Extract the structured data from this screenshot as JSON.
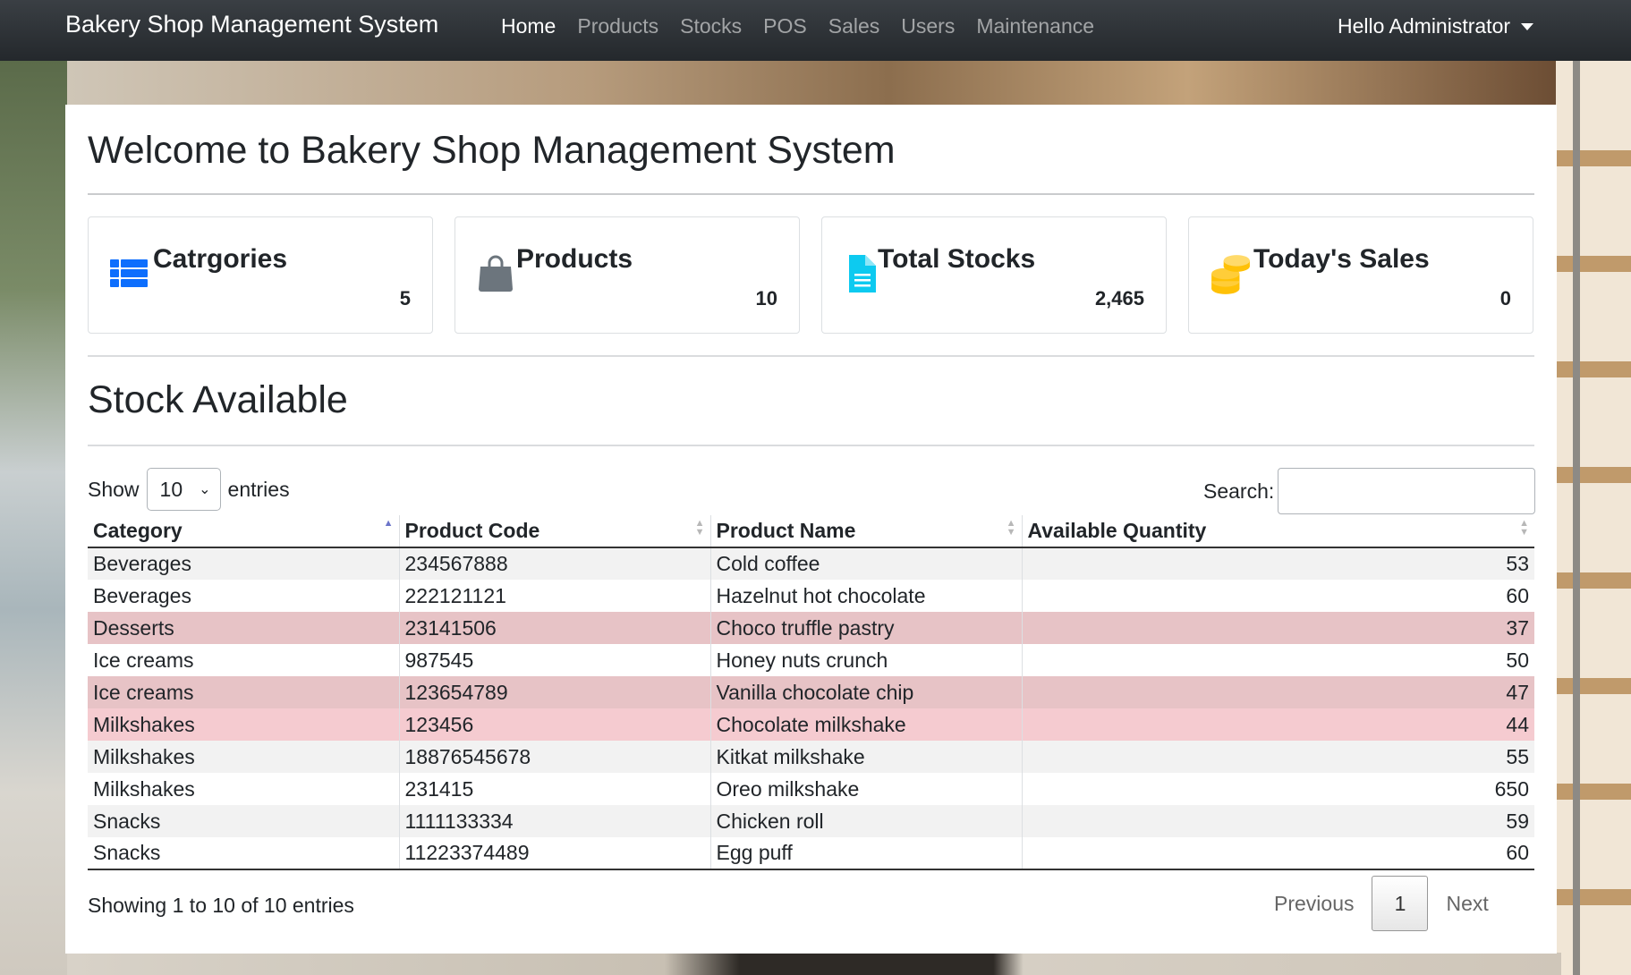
{
  "navbar": {
    "brand": "Bakery Shop Management System",
    "links": [
      "Home",
      "Products",
      "Stocks",
      "POS",
      "Sales",
      "Users",
      "Maintenance"
    ],
    "active": "Home",
    "user": "Hello Administrator"
  },
  "welcome": "Welcome to Bakery Shop Management System",
  "stats": [
    {
      "label": "Catrgories",
      "value": "5",
      "icon": "grid-list-icon",
      "color": "#0d6efd"
    },
    {
      "label": "Products",
      "value": "10",
      "icon": "shopping-bag-icon",
      "color": "#6c757d"
    },
    {
      "label": "Total Stocks",
      "value": "2,465",
      "icon": "file-document-icon",
      "color": "#0dcaf0"
    },
    {
      "label": "Today's Sales",
      "value": "0",
      "icon": "coins-icon",
      "color": "#ffc107"
    }
  ],
  "stock": {
    "title": "Stock Available",
    "show_label": "Show",
    "entries_label": "entries",
    "page_size": "10",
    "search_label": "Search:",
    "columns": [
      "Category",
      "Product Code",
      "Product Name",
      "Available Quantity"
    ],
    "rows": [
      [
        "Beverages",
        "234567888",
        "Cold coffee",
        "53"
      ],
      [
        "Beverages",
        "222121121",
        "Hazelnut hot chocolate",
        "60"
      ],
      [
        "Desserts",
        "23141506",
        "Choco truffle pastry",
        "37"
      ],
      [
        "Ice creams",
        "987545",
        "Honey nuts crunch",
        "50"
      ],
      [
        "Ice creams",
        "123654789",
        "Vanilla chocolate chip",
        "47"
      ],
      [
        "Milkshakes",
        "123456",
        "Chocolate milkshake",
        "44"
      ],
      [
        "Milkshakes",
        "18876545678",
        "Kitkat milkshake",
        "55"
      ],
      [
        "Milkshakes",
        "231415",
        "Oreo milkshake",
        "650"
      ],
      [
        "Snacks",
        "1111133334",
        "Chicken roll",
        "59"
      ],
      [
        "Snacks",
        "11223374489",
        "Egg puff",
        "60"
      ]
    ],
    "row_styles": [
      "odd",
      "even",
      "danger",
      "even",
      "danger",
      "danger2",
      "odd",
      "even",
      "odd",
      "even"
    ],
    "info": "Showing 1 to 10 of 10 entries",
    "previous": "Previous",
    "page": "1",
    "next": "Next"
  }
}
